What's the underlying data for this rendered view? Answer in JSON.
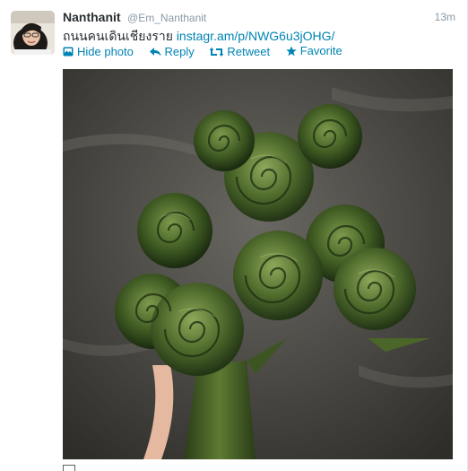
{
  "tweet": {
    "fullname": "Nanthanit",
    "username": "@Em_Nanthanit",
    "timestamp": "13m",
    "text": "ถนนคนเดินเชียงราย",
    "link": "instagr.am/p/NWG6u3jOHG/"
  },
  "actions": {
    "hide_photo": "Hide photo",
    "reply": "Reply",
    "retweet": "Retweet",
    "favorite": "Favorite"
  },
  "icons": {
    "photo": "photo-icon",
    "reply": "reply-arrow-icon",
    "retweet": "retweet-icon",
    "favorite": "star-icon"
  },
  "colors": {
    "link": "#0084b4",
    "name": "#292f33",
    "meta": "#8899a6"
  }
}
